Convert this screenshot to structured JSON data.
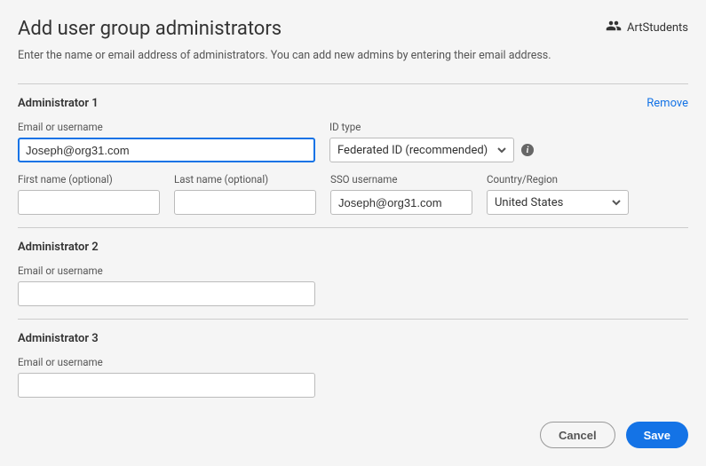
{
  "header": {
    "title": "Add user group administrators",
    "group_name": "ArtStudents",
    "subtitle": "Enter the name or email address of administrators. You can add new admins by entering their email address."
  },
  "labels": {
    "email_or_username": "Email or username",
    "id_type": "ID type",
    "first_name": "First name (optional)",
    "last_name": "Last name (optional)",
    "sso_username": "SSO username",
    "country_region": "Country/Region",
    "remove": "Remove"
  },
  "admin1": {
    "section_label": "Administrator 1",
    "email_value": "Joseph@org31.com",
    "id_type_value": "Federated ID (recommended)",
    "first_name_value": "",
    "last_name_value": "",
    "sso_username_value": "Joseph@org31.com",
    "country_value": "United States"
  },
  "admin2": {
    "section_label": "Administrator 2",
    "email_value": ""
  },
  "admin3": {
    "section_label": "Administrator 3",
    "email_value": ""
  },
  "footer": {
    "cancel": "Cancel",
    "save": "Save"
  }
}
